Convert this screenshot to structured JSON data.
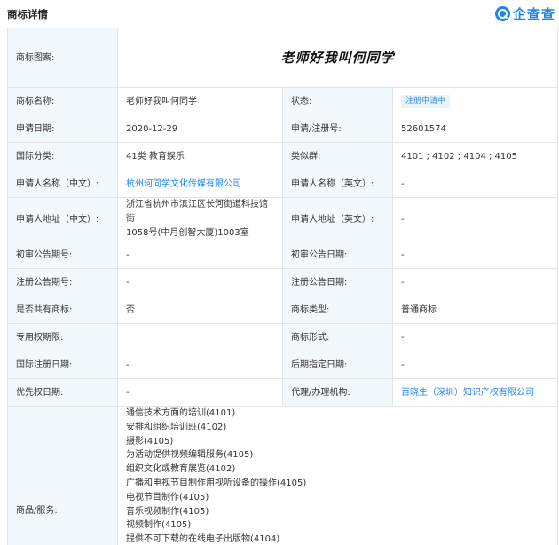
{
  "header": {
    "title": "商标详情",
    "logo_text": "企查查"
  },
  "labels": {
    "pattern": "商标图案:",
    "name": "商标名称:",
    "status": "状态:",
    "apply_date": "申请日期:",
    "reg_no": "申请/注册号:",
    "intl_class": "国际分类:",
    "similar_group": "类似群:",
    "applicant_cn": "申请人名称（中文）:",
    "applicant_en": "申请人名称（英文）:",
    "address_cn": "申请人地址（中文）:",
    "address_en": "申请人地址（英文）:",
    "prelim_pub_no": "初审公告期号:",
    "prelim_pub_date": "初审公告日期:",
    "reg_pub_no": "注册公告期号:",
    "reg_pub_date": "注册公告日期:",
    "shared": "是否共有商标:",
    "tm_type": "商标类型:",
    "exclusive_period": "专用权期限:",
    "tm_form": "商标形式:",
    "intl_reg_date": "国际注册日期:",
    "later_designation_date": "后期指定日期:",
    "priority_date": "优先权日期:",
    "agent": "代理/办理机构:",
    "goods": "商品/服务:"
  },
  "values": {
    "pattern_text": "老师好我叫何同学",
    "name": "老师好我叫何同学",
    "status": "注册申请中",
    "apply_date": "2020-12-29",
    "reg_no": "52601574",
    "intl_class": "41类 教育娱乐",
    "similar_group": "4101 ; 4102 ; 4104 ; 4105",
    "applicant_cn": "杭州何同学文化传媒有限公司",
    "applicant_en": "-",
    "address_cn_line1": "浙江省杭州市滨江区长河街道科技馆街",
    "address_cn_line2": "1058号(中月创智大厦)1003室",
    "address_en": "-",
    "prelim_pub_no": "-",
    "prelim_pub_date": "-",
    "reg_pub_no": "-",
    "reg_pub_date": "-",
    "shared": "否",
    "tm_type": "普通商标",
    "exclusive_period": "",
    "tm_form": "-",
    "intl_reg_date": "-",
    "later_designation_date": "-",
    "priority_date": "-",
    "agent": "百晓生（深圳）知识产权有限公司"
  },
  "goods": [
    "通信技术方面的培训(4101)",
    "安排和组织培训班(4102)",
    "摄影(4105)",
    "为活动提供视频编辑服务(4105)",
    "组织文化或教育展览(4102)",
    "广播和电视节目制作用视听设备的操作(4105)",
    "电视节目制作(4105)",
    "音乐视频制作(4105)",
    "视频制作(4105)",
    "提供不可下载的在线电子出版物(4104)"
  ],
  "colors": {
    "accent": "#1f86f0",
    "label_bg": "#f2f9fc",
    "border": "#e4e4e4",
    "badge_bg": "#e8f3fd",
    "badge_text": "#3b8ed8"
  }
}
